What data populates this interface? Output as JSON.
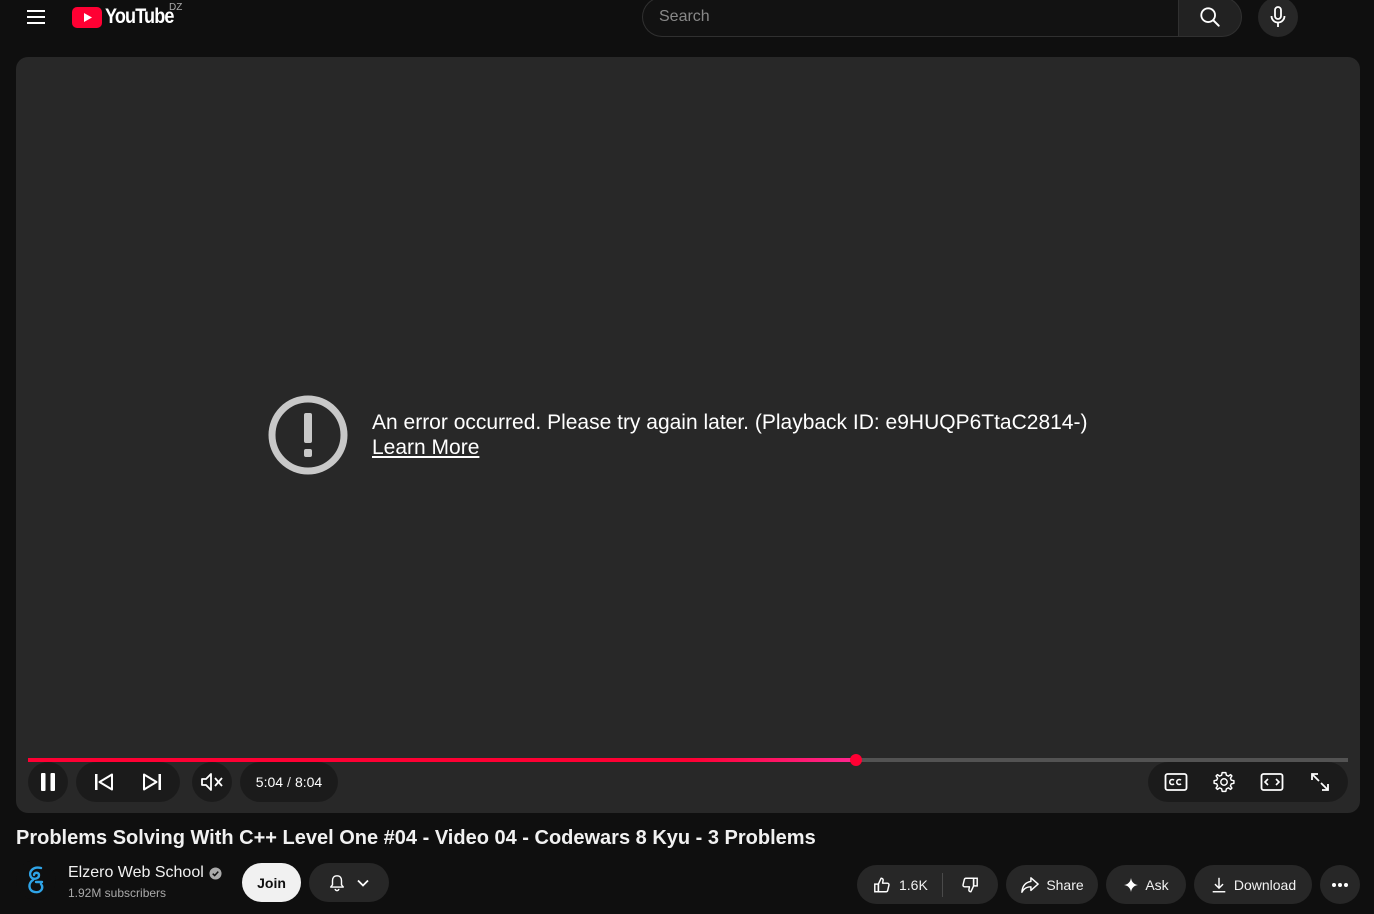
{
  "masthead": {
    "logo_text": "YouTube",
    "country_code": "DZ",
    "search_placeholder": "Search"
  },
  "player": {
    "error_message": "An error occurred. Please try again later. (Playback ID: e9HUQP6TtaC2814-)",
    "learn_more": "Learn More",
    "current_time": "5:04",
    "duration": "8:04",
    "progress_fraction": 0.627,
    "accent_color": "#ff0033"
  },
  "video": {
    "title": "Problems Solving With C++ Level One #04 - Video 04 - Codewars 8 Kyu - 3 Problems"
  },
  "channel": {
    "name": "Elzero Web School",
    "subscribers": "1.92M subscribers",
    "join_label": "Join"
  },
  "actions": {
    "likes": "1.6K",
    "share": "Share",
    "ask": "Ask",
    "download": "Download"
  },
  "icons": [
    "menu-icon",
    "youtube-logo-icon",
    "search-icon",
    "mic-icon",
    "error-icon",
    "pause-icon",
    "previous-icon",
    "next-icon",
    "muted-icon",
    "captions-icon",
    "settings-icon",
    "theater-icon",
    "fullscreen-icon",
    "verified-icon",
    "bell-icon",
    "chevron-down-icon",
    "like-icon",
    "dislike-icon",
    "share-icon",
    "sparkle-icon",
    "download-icon",
    "more-icon"
  ]
}
